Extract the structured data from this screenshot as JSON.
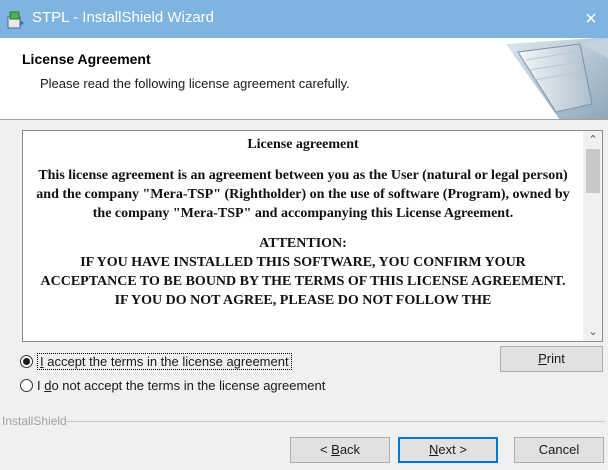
{
  "window": {
    "title": "STPL - InstallShield Wizard",
    "close_glyph": "×"
  },
  "header": {
    "title": "License Agreement",
    "subtitle": "Please read the following license agreement carefully."
  },
  "license": {
    "title": "License agreement",
    "paragraph": "This license agreement is an agreement between you as the User (natural or legal person) and the company \"Mera-TSP\" (Rightholder) on the use of software (Program), owned by the company \"Mera-TSP\" and accompanying this License Agreement.",
    "attention": "ATTENTION:",
    "caps_text": "IF YOU HAVE INSTALLED THIS SOFTWARE, YOU CONFIRM YOUR ACCEPTANCE TO BE BOUND BY THE TERMS OF THIS LICENSE AGREEMENT. IF YOU DO NOT AGREE, PLEASE DO NOT FOLLOW THE",
    "scroll_up_glyph": "⌃",
    "scroll_down_glyph": "⌄"
  },
  "options": {
    "accept": {
      "before": "",
      "mnemonic": "I",
      "after": " accept the terms in the license agreement",
      "checked": true
    },
    "decline": {
      "before": "I ",
      "mnemonic": "d",
      "after": "o not accept the terms in the license agreement",
      "checked": false
    }
  },
  "buttons": {
    "print": {
      "mnemonic": "P",
      "rest": "rint"
    },
    "back": {
      "before": "< ",
      "mnemonic": "B",
      "rest": "ack"
    },
    "next": {
      "mnemonic": "N",
      "rest": "ext >"
    },
    "cancel": "Cancel"
  },
  "brand": "InstallShield",
  "colors": {
    "titlebar": "#7fb3e0",
    "focus_border": "#0078d7"
  }
}
